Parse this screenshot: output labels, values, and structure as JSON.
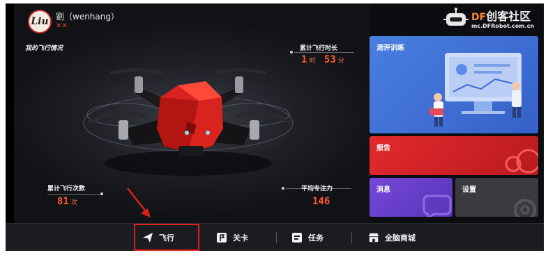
{
  "user": {
    "avatar_text": "Liu",
    "name": "劉（wenhang）",
    "rank": "✕✕"
  },
  "main": {
    "section_title": "我的飞行情况",
    "stats": {
      "flight_time_label": "累计飞行时长",
      "flight_time_hours": "1",
      "hours_unit": "时",
      "flight_time_minutes": "53",
      "minutes_unit": "分",
      "flight_count_label": "累计飞行次数",
      "flight_count": "81",
      "count_unit": "次",
      "focus_label": "平均专注力",
      "focus_value": "146"
    }
  },
  "watermark": {
    "prefix": "DF",
    "text": "创客社区",
    "url": "mc.DFRobot.com.cn"
  },
  "cards": {
    "training": "测评训练",
    "report": "报告",
    "messages": "消息",
    "settings": "设置"
  },
  "nav": {
    "flight": "飞行",
    "levels": "关卡",
    "tasks": "任务",
    "mall": "全脑商城"
  },
  "colors": {
    "accent_orange": "#ff5a2a",
    "training_card": "#3d6fd6",
    "report_card": "#d8232a",
    "messages_card": "#6a3fc8",
    "settings_card": "#3a3b40",
    "highlight": "#e0201c"
  },
  "icons": {
    "flight": "paper-plane-icon",
    "levels": "flag-icon",
    "tasks": "task-list-icon",
    "mall": "shop-icon"
  }
}
